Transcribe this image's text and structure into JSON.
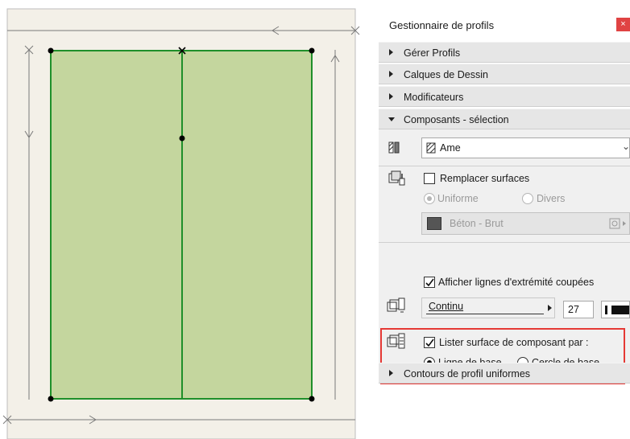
{
  "panel": {
    "title": "Gestionnaire de profils",
    "close_glyph": "×",
    "sections": {
      "gerer_profils": "Gérer Profils",
      "calques": "Calques de Dessin",
      "modificateurs": "Modificateurs",
      "composants": "Composants - sélection",
      "contours": "Contours de profil uniformes"
    },
    "component_select": {
      "value": "Ame"
    },
    "remplacer_surfaces": {
      "label": "Remplacer surfaces",
      "checked": false
    },
    "radio_uniforme": "Uniforme",
    "radio_divers": "Divers",
    "surface_material": "Béton - Brut",
    "afficher_lignes": {
      "label": "Afficher lignes d'extrémité coupées",
      "checked": true
    },
    "line_type": "Continu",
    "pen_number": "27",
    "lister_surface": {
      "label": "Lister surface de composant par :",
      "checked": true
    },
    "radio_ligne_base": {
      "label": "Ligne de base",
      "selected": true
    },
    "radio_cercle_base": {
      "label": "Cercle de base",
      "selected": false
    }
  },
  "colors": {
    "canvas_bg": "#f3f0e8",
    "profile_fill": "#c4d69e",
    "profile_edge": "#1f8f2a",
    "highlight": "#e53935"
  }
}
